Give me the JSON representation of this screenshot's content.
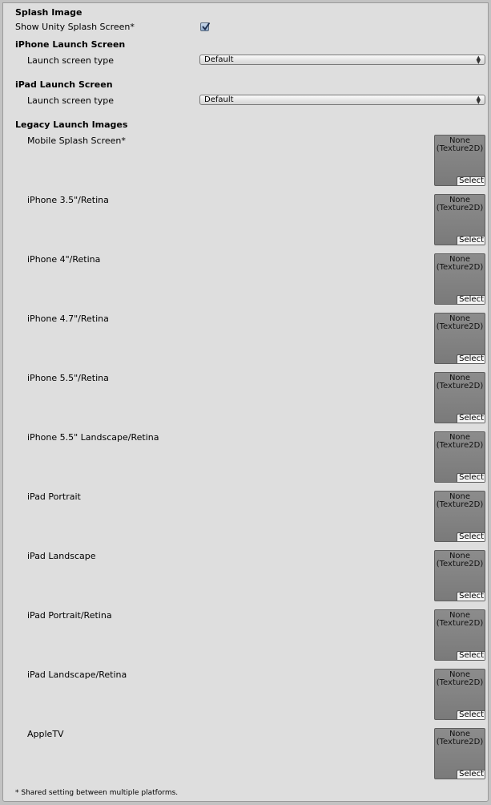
{
  "splash_image": {
    "header": "Splash Image",
    "show_unity_splash_label": "Show Unity Splash Screen*",
    "show_unity_splash_checked": true
  },
  "iphone_launch": {
    "header": "iPhone Launch Screen",
    "type_label": "Launch screen type",
    "type_value": "Default"
  },
  "ipad_launch": {
    "header": "iPad Launch Screen",
    "type_label": "Launch screen type",
    "type_value": "Default"
  },
  "legacy": {
    "header": "Legacy Launch Images",
    "slot_none_text": "None\n(Texture2D)",
    "slot_none_line1": "None",
    "slot_none_line2": "(Texture2D)",
    "select_label": "Select",
    "items": [
      {
        "label": "Mobile Splash Screen*"
      },
      {
        "label": "iPhone 3.5\"/Retina"
      },
      {
        "label": "iPhone 4\"/Retina"
      },
      {
        "label": "iPhone 4.7\"/Retina"
      },
      {
        "label": "iPhone 5.5\"/Retina"
      },
      {
        "label": "iPhone 5.5\" Landscape/Retina"
      },
      {
        "label": "iPad Portrait"
      },
      {
        "label": "iPad Landscape"
      },
      {
        "label": "iPad Portrait/Retina"
      },
      {
        "label": "iPad Landscape/Retina"
      },
      {
        "label": "AppleTV"
      }
    ]
  },
  "footer": {
    "note": "* Shared setting between multiple platforms."
  }
}
